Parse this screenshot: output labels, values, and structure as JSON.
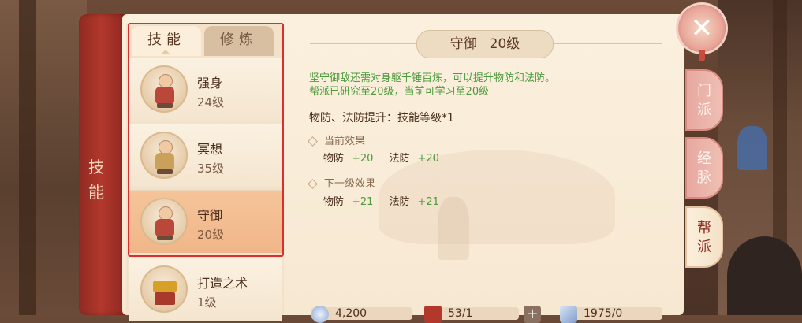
{
  "spine": {
    "title_char1": "技",
    "title_char2": "能"
  },
  "tabs": [
    {
      "label": "技能",
      "active": true
    },
    {
      "label": "修炼",
      "active": false
    }
  ],
  "skills": [
    {
      "name": "强身",
      "level": "24级",
      "icon": "monk-figure-icon"
    },
    {
      "name": "冥想",
      "level": "35级",
      "icon": "monk-figure-icon"
    },
    {
      "name": "守御",
      "level": "20级",
      "icon": "monk-figure-icon",
      "selected": true
    },
    {
      "name": "打造之术",
      "level": "1级",
      "icon": "anvil-icon"
    }
  ],
  "detail": {
    "skill_name": "守御",
    "skill_level": "20级",
    "description": "坚守御敌还需对身躯千锤百炼，可以提升物防和法防。",
    "research_info": "帮派已研究至20级，当前可学习至20级",
    "upgrade_rule": "物防、法防提升：技能等级*1",
    "current": {
      "title": "当前效果",
      "stats": [
        {
          "label": "物防",
          "value": "+20"
        },
        {
          "label": "法防",
          "value": "+20"
        }
      ]
    },
    "next": {
      "title": "下一级效果",
      "stats": [
        {
          "label": "物防",
          "value": "+21"
        },
        {
          "label": "法防",
          "value": "+21"
        }
      ]
    }
  },
  "resources": [
    {
      "icon": "silver-coin-icon",
      "value": "4,200"
    },
    {
      "icon": "guild-token-icon",
      "value": "53/1"
    },
    {
      "icon": "add-icon",
      "value": ""
    },
    {
      "icon": "contribution-icon",
      "value": "1975/0"
    }
  ],
  "side_tabs": [
    {
      "label1": "门",
      "label2": "派",
      "active": false
    },
    {
      "label1": "经",
      "label2": "脉",
      "active": false
    },
    {
      "label1": "帮",
      "label2": "派",
      "active": true
    }
  ],
  "colors": {
    "accent_red": "#b3382c",
    "green_text": "#4d9b3d",
    "panel_bg": "#fbf0de"
  }
}
